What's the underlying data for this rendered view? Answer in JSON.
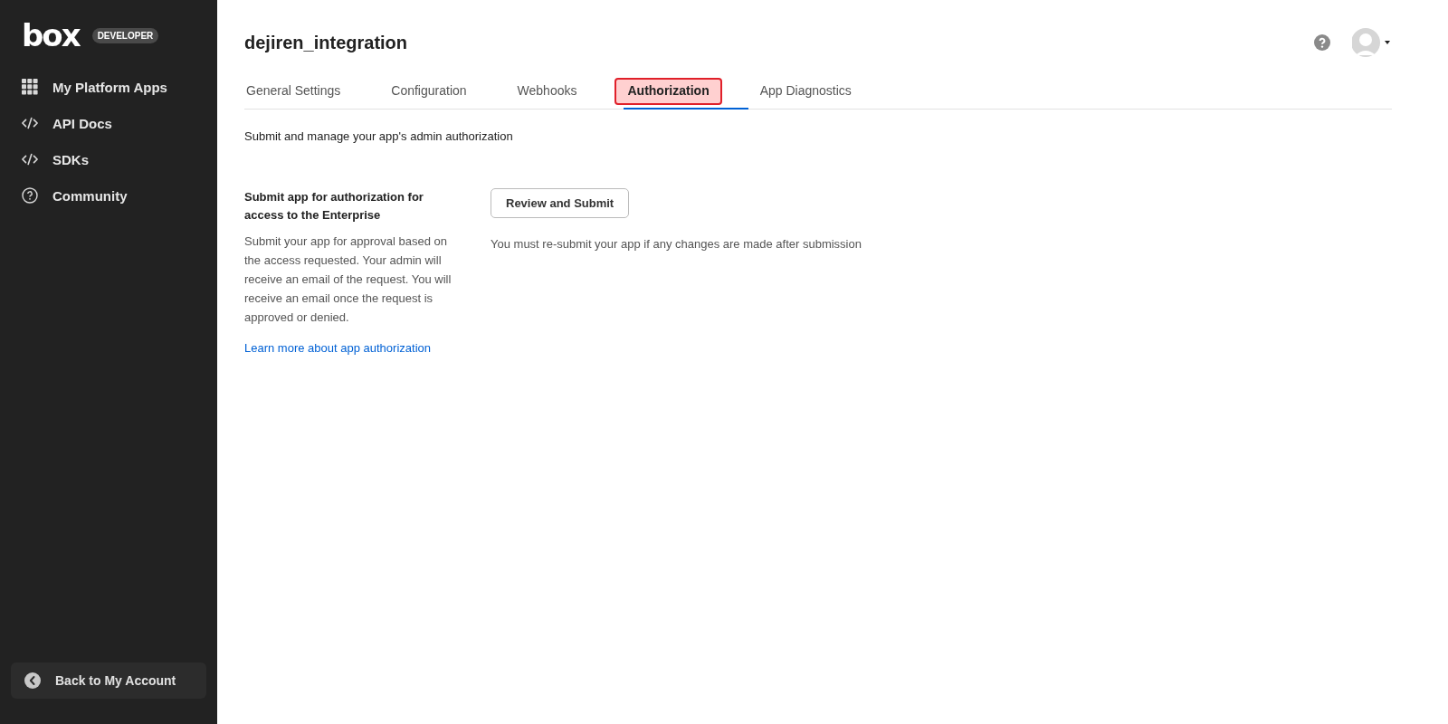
{
  "sidebar": {
    "logo": "box",
    "badge": "DEVELOPER",
    "items": [
      {
        "label": "My Platform Apps",
        "kind": "grid"
      },
      {
        "label": "API Docs",
        "kind": "code"
      },
      {
        "label": "SDKs",
        "kind": "code"
      },
      {
        "label": "Community",
        "kind": "help"
      }
    ],
    "back_button": "Back to My Account"
  },
  "header": {
    "title": "dejiren_integration"
  },
  "tabs": [
    {
      "label": "General Settings",
      "selected": false
    },
    {
      "label": "Configuration",
      "selected": false
    },
    {
      "label": "Webhooks",
      "selected": false
    },
    {
      "label": "Authorization",
      "selected": true
    },
    {
      "label": "App Diagnostics",
      "selected": false
    }
  ],
  "intro": "Submit and manage your app's admin authorization",
  "section": {
    "heading": "Submit app for authorization for access to the Enterprise",
    "description": "Submit your app for approval based on the access requested. Your admin will receive an email of the request. You will receive an email once the request is approved or denied.",
    "link": "Learn more about app authorization",
    "button": "Review and Submit",
    "note": "You must re-submit your app if any changes are made after submission"
  }
}
